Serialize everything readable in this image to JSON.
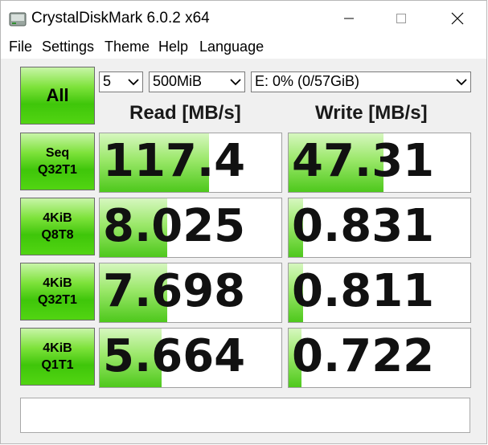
{
  "window": {
    "title": "CrystalDiskMark 6.0.2 x64"
  },
  "menu": [
    "File",
    "Settings",
    "Theme",
    "Help",
    "Language"
  ],
  "controls": {
    "all_label": "All",
    "count": "5",
    "size": "500MiB",
    "drive": "E: 0% (0/57GiB)"
  },
  "headers": {
    "read": "Read [MB/s]",
    "write": "Write [MB/s]"
  },
  "tests": [
    {
      "line1": "Seq",
      "line2": "Q32T1",
      "read": "117.4",
      "write": "47.31",
      "read_fill": 0.6,
      "write_fill": 0.52
    },
    {
      "line1": "4KiB",
      "line2": "Q8T8",
      "read": "8.025",
      "write": "0.831",
      "read_fill": 0.37,
      "write_fill": 0.08
    },
    {
      "line1": "4KiB",
      "line2": "Q32T1",
      "read": "7.698",
      "write": "0.811",
      "read_fill": 0.37,
      "write_fill": 0.08
    },
    {
      "line1": "4KiB",
      "line2": "Q1T1",
      "read": "5.664",
      "write": "0.722",
      "read_fill": 0.34,
      "write_fill": 0.07
    }
  ],
  "comment": ""
}
